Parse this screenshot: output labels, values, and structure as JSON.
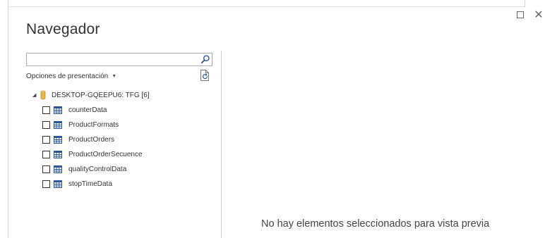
{
  "window": {
    "title": "Navegador",
    "maximize_icon": "maximize-icon",
    "close_glyph": "✕"
  },
  "search": {
    "value": "",
    "placeholder": "",
    "icon": "search-icon"
  },
  "display_options": {
    "label": "Opciones de presentación",
    "caret": "▼",
    "refresh_icon": "refresh-icon"
  },
  "tree": {
    "root": {
      "expander": "◢",
      "label": "DESKTOP-GQEEPU6: TFG [6]",
      "icon": "database-icon",
      "icon_color": "#e8b84a"
    },
    "items": [
      {
        "label": "counterData",
        "checked": false
      },
      {
        "label": "ProductFormats",
        "checked": false
      },
      {
        "label": "ProductOrders",
        "checked": false
      },
      {
        "label": "ProductOrderSecuence",
        "checked": false
      },
      {
        "label": "qualityControlData",
        "checked": false
      },
      {
        "label": "stopTimeData",
        "checked": false
      }
    ]
  },
  "preview": {
    "empty_message": "No hay elementos seleccionados para vista previa"
  },
  "colors": {
    "table_icon": "#2b579a",
    "text": "#333333",
    "border": "#adadad"
  }
}
